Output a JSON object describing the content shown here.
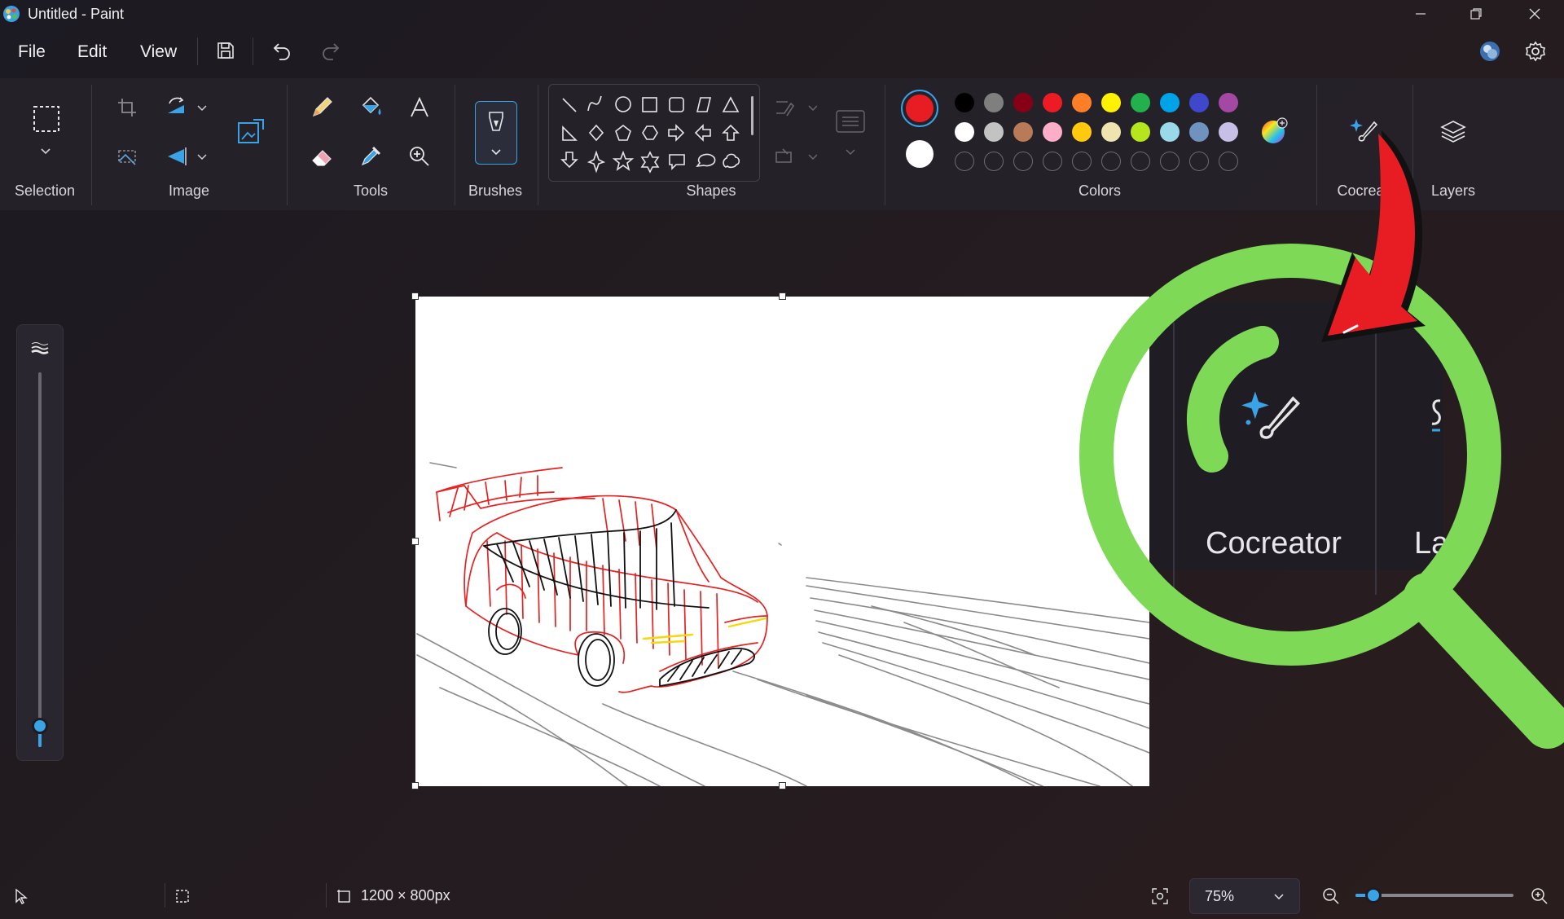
{
  "app": {
    "title": "Untitled - Paint"
  },
  "menu": {
    "file": "File",
    "edit": "Edit",
    "view": "View"
  },
  "ribbon": {
    "groups": {
      "selection": "Selection",
      "image": "Image",
      "tools": "Tools",
      "brushes": "Brushes",
      "shapes": "Shapes",
      "colors": "Colors",
      "cocreator": "Cocreat",
      "layers": "Layers"
    }
  },
  "colors": {
    "primary": "#e81c23",
    "secondary": "#ffffff",
    "row1": [
      "#000000",
      "#7f7f7f",
      "#880015",
      "#ed1c24",
      "#ff7f27",
      "#fff200",
      "#22b14c",
      "#00a2e8",
      "#3f48cc",
      "#a349a4"
    ],
    "row2": [
      "#ffffff",
      "#c3c3c3",
      "#b97a57",
      "#ffaec9",
      "#ffc90e",
      "#efe4b0",
      "#b5e61d",
      "#99d9ea",
      "#7092be",
      "#c8bfe7"
    ]
  },
  "overlay": {
    "zoomed_label": "Cocreator",
    "zoomed_partial": "La",
    "magnifier_color": "#7ed957",
    "arrow_color": "#e81c23"
  },
  "status": {
    "canvas_size": "1200 × 800px",
    "zoom": "75%",
    "zoom_fraction": 0.1
  }
}
